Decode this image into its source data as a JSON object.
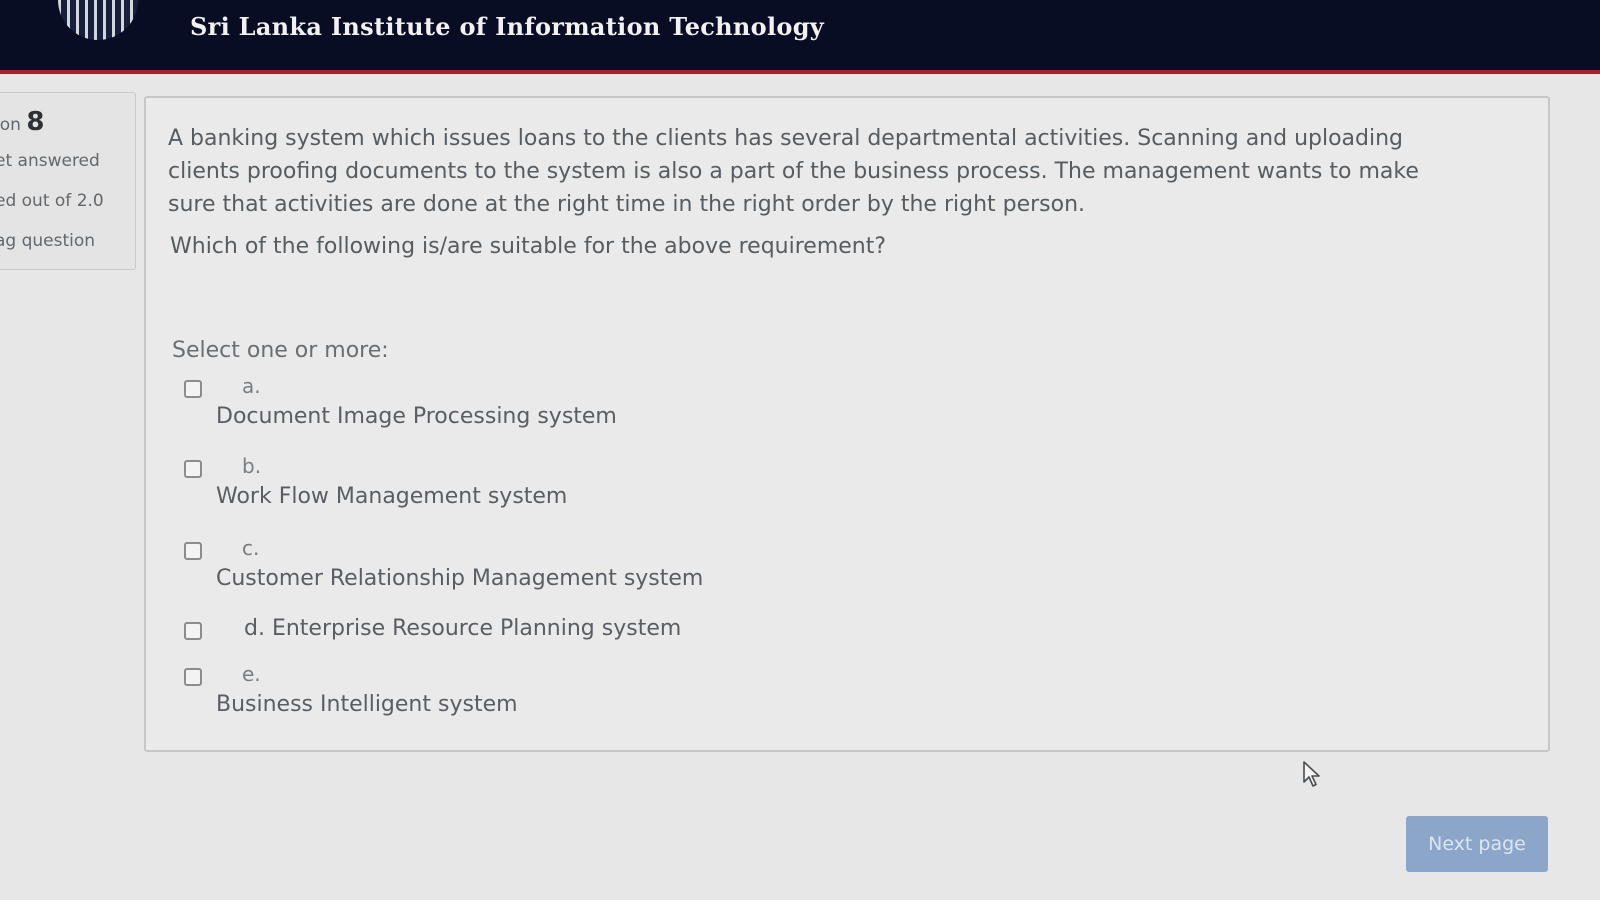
{
  "header": {
    "title": "Sri Lanka Institute of Information Technology",
    "logo_icon": "globe-grid-logo"
  },
  "info": {
    "question_prefix": "ion",
    "question_number": "8",
    "status": "et answered",
    "marks": "ed out of 2.0",
    "flag": "ag question"
  },
  "question": {
    "text": "A banking system which issues loans to the clients has several departmental activities. Scanning and uploading clients proofing documents to the system is also a part of the business process. The management wants to make sure that activities are done at the right time in the right order by the right person.",
    "prompt": "Which of the following is/are suitable for the above requirement?",
    "select_label": "Select one or more:",
    "options": [
      {
        "letter": "a.",
        "text": "Document Image Processing system",
        "checked": false
      },
      {
        "letter": "b.",
        "text": "Work Flow Management system",
        "checked": false
      },
      {
        "letter": "c.",
        "text": "Customer Relationship Management system",
        "checked": false
      },
      {
        "letter": "d.",
        "text": "d. Enterprise Resource Planning system",
        "checked": false
      },
      {
        "letter": "e.",
        "text": "Business Intelligent system",
        "checked": false
      }
    ]
  },
  "navigation": {
    "next_label": "Next page"
  },
  "colors": {
    "header_bg": "#080d24",
    "header_border": "#b11f2c",
    "button_bg": "#8ca6c9"
  }
}
